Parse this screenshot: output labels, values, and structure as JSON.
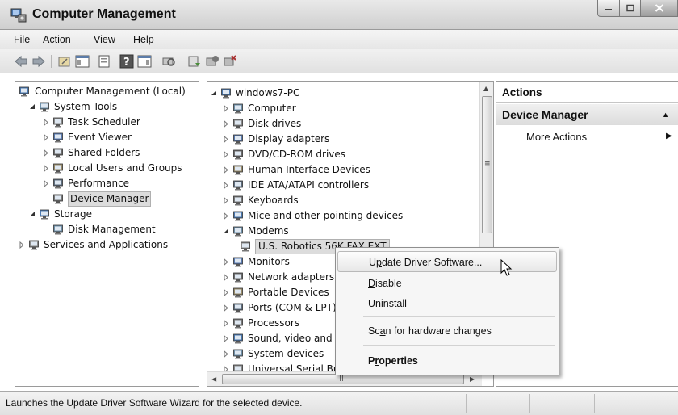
{
  "window": {
    "title": "Computer Management"
  },
  "menu": [
    {
      "label": "File",
      "accel": "F",
      "rest": "ile"
    },
    {
      "label": "Action",
      "accel": "A",
      "rest": "ction"
    },
    {
      "label": "View",
      "accel": "V",
      "rest": "iew"
    },
    {
      "label": "Help",
      "accel": "H",
      "rest": "elp"
    }
  ],
  "toolbar_icons": [
    "back-icon",
    "forward-icon",
    "up-icon",
    "show-hide-tree-icon",
    "properties-icon",
    "help-icon",
    "show-hide-action-icon",
    "scan-hardware-icon",
    "update-driver-icon",
    "disable-device-icon",
    "uninstall-device-icon"
  ],
  "left_tree": [
    {
      "label": "Computer Management (Local)",
      "level": 0,
      "twisty": "none",
      "icon": "computer-management-icon"
    },
    {
      "label": "System Tools",
      "level": 1,
      "twisty": "open",
      "icon": "tools-icon"
    },
    {
      "label": "Task Scheduler",
      "level": 2,
      "twisty": "closed",
      "icon": "clock-icon"
    },
    {
      "label": "Event Viewer",
      "level": 2,
      "twisty": "closed",
      "icon": "event-viewer-icon"
    },
    {
      "label": "Shared Folders",
      "level": 2,
      "twisty": "closed",
      "icon": "shared-folders-icon"
    },
    {
      "label": "Local Users and Groups",
      "level": 2,
      "twisty": "closed",
      "icon": "users-icon"
    },
    {
      "label": "Performance",
      "level": 2,
      "twisty": "closed",
      "icon": "performance-icon"
    },
    {
      "label": "Device Manager",
      "level": 2,
      "twisty": "none",
      "icon": "device-manager-icon",
      "selected": true
    },
    {
      "label": "Storage",
      "level": 1,
      "twisty": "open",
      "icon": "storage-icon"
    },
    {
      "label": "Disk Management",
      "level": 2,
      "twisty": "none",
      "icon": "disk-management-icon"
    },
    {
      "label": "Services and Applications",
      "level": 0,
      "twisty": "closed",
      "icon": "services-icon"
    }
  ],
  "device_tree": [
    {
      "label": "windows7-PC",
      "icon": "computer-icon"
    },
    {
      "label": "Computer",
      "icon": "computer-icon"
    },
    {
      "label": "Disk drives",
      "icon": "disk-drive-icon"
    },
    {
      "label": "Display adapters",
      "icon": "display-adapter-icon"
    },
    {
      "label": "DVD/CD-ROM drives",
      "icon": "dvd-drive-icon"
    },
    {
      "label": "Human Interface Devices",
      "icon": "hid-icon"
    },
    {
      "label": "IDE ATA/ATAPI controllers",
      "icon": "ide-controller-icon"
    },
    {
      "label": "Keyboards",
      "icon": "keyboard-icon"
    },
    {
      "label": "Mice and other pointing devices",
      "icon": "mouse-icon"
    },
    {
      "label": "Modems",
      "icon": "modem-icon"
    },
    {
      "label": "U.S. Robotics 56K FAX EXT",
      "icon": "modem-device-icon",
      "selected": true
    },
    {
      "label": "Monitors",
      "icon": "monitor-icon"
    },
    {
      "label": "Network adapters",
      "icon": "network-adapter-icon"
    },
    {
      "label": "Portable Devices",
      "icon": "portable-device-icon"
    },
    {
      "label": "Ports (COM & LPT)",
      "icon": "port-icon"
    },
    {
      "label": "Processors",
      "icon": "processor-icon"
    },
    {
      "label": "Sound, video and game controllers",
      "icon": "sound-icon"
    },
    {
      "label": "System devices",
      "icon": "system-device-icon"
    },
    {
      "label": "Universal Serial Bus controllers",
      "icon": "usb-icon"
    }
  ],
  "actions": {
    "header": "Actions",
    "section": "Device Manager",
    "more": "More Actions"
  },
  "context_menu": [
    {
      "pre": "U",
      "accel": "p",
      "post": "date Driver Software...",
      "active": true
    },
    {
      "pre": "",
      "accel": "D",
      "post": "isable"
    },
    {
      "pre": "",
      "accel": "U",
      "post": "ninstall"
    },
    {
      "pre": "Sc",
      "accel": "a",
      "post": "n for hardware changes"
    },
    {
      "pre": "P",
      "accel": "r",
      "post": "operties",
      "bold": true
    }
  ],
  "status": "Launches the Update Driver Software Wizard for the selected device.",
  "colors": {
    "selection": "#dcdcdc",
    "pane_border": "#9a9a9a"
  }
}
